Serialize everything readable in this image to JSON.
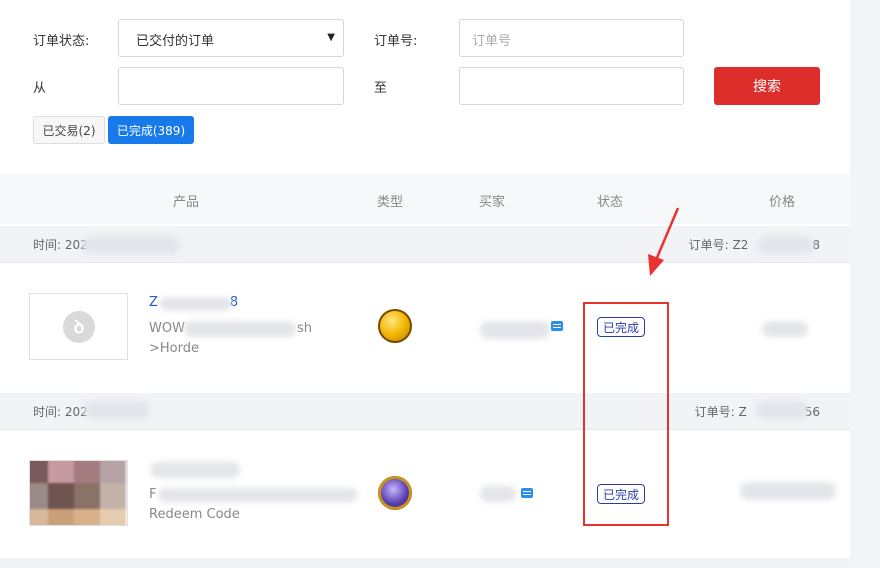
{
  "filters": {
    "order_status_label": "订单状态:",
    "order_status_value": "已交付的订单",
    "order_no_label": "订单号:",
    "order_no_placeholder": "订单号",
    "from_label": "从",
    "to_label": "至",
    "search_button": "搜索"
  },
  "chips": [
    {
      "label": "已交易(2)",
      "active": false
    },
    {
      "label": "已完成(389)",
      "active": true
    }
  ],
  "table": {
    "headers": [
      "产品",
      "类型",
      "买家",
      "状态",
      "价格"
    ]
  },
  "orders": [
    {
      "time_prefix": "时间: 202",
      "order_no_prefix": "订单号: Z2",
      "order_no_suffix": "8",
      "title_prefix": "Z",
      "title_suffix": "8",
      "desc_line1_prefix": "WOW",
      "desc_line1_suffix": "sh",
      "desc_line2": ">Horde",
      "status": "已完成"
    },
    {
      "time_prefix": "时间: 202",
      "order_no_prefix": "订单号: Z",
      "order_no_suffix": "56",
      "desc_line1_prefix": "F",
      "desc_line2": "Redeem Code",
      "status": "已完成"
    }
  ],
  "colors": {
    "accent_red": "#dd2e2b",
    "chip_blue": "#1879ea",
    "status_blue": "#2b3ea8",
    "highlight_red": "#e8322f"
  },
  "icons": {
    "dropdown": "caret-down-icon",
    "chat": "chat-bubble-icon",
    "gold_type": "gold-coin-icon",
    "item_type": "purple-item-icon"
  }
}
